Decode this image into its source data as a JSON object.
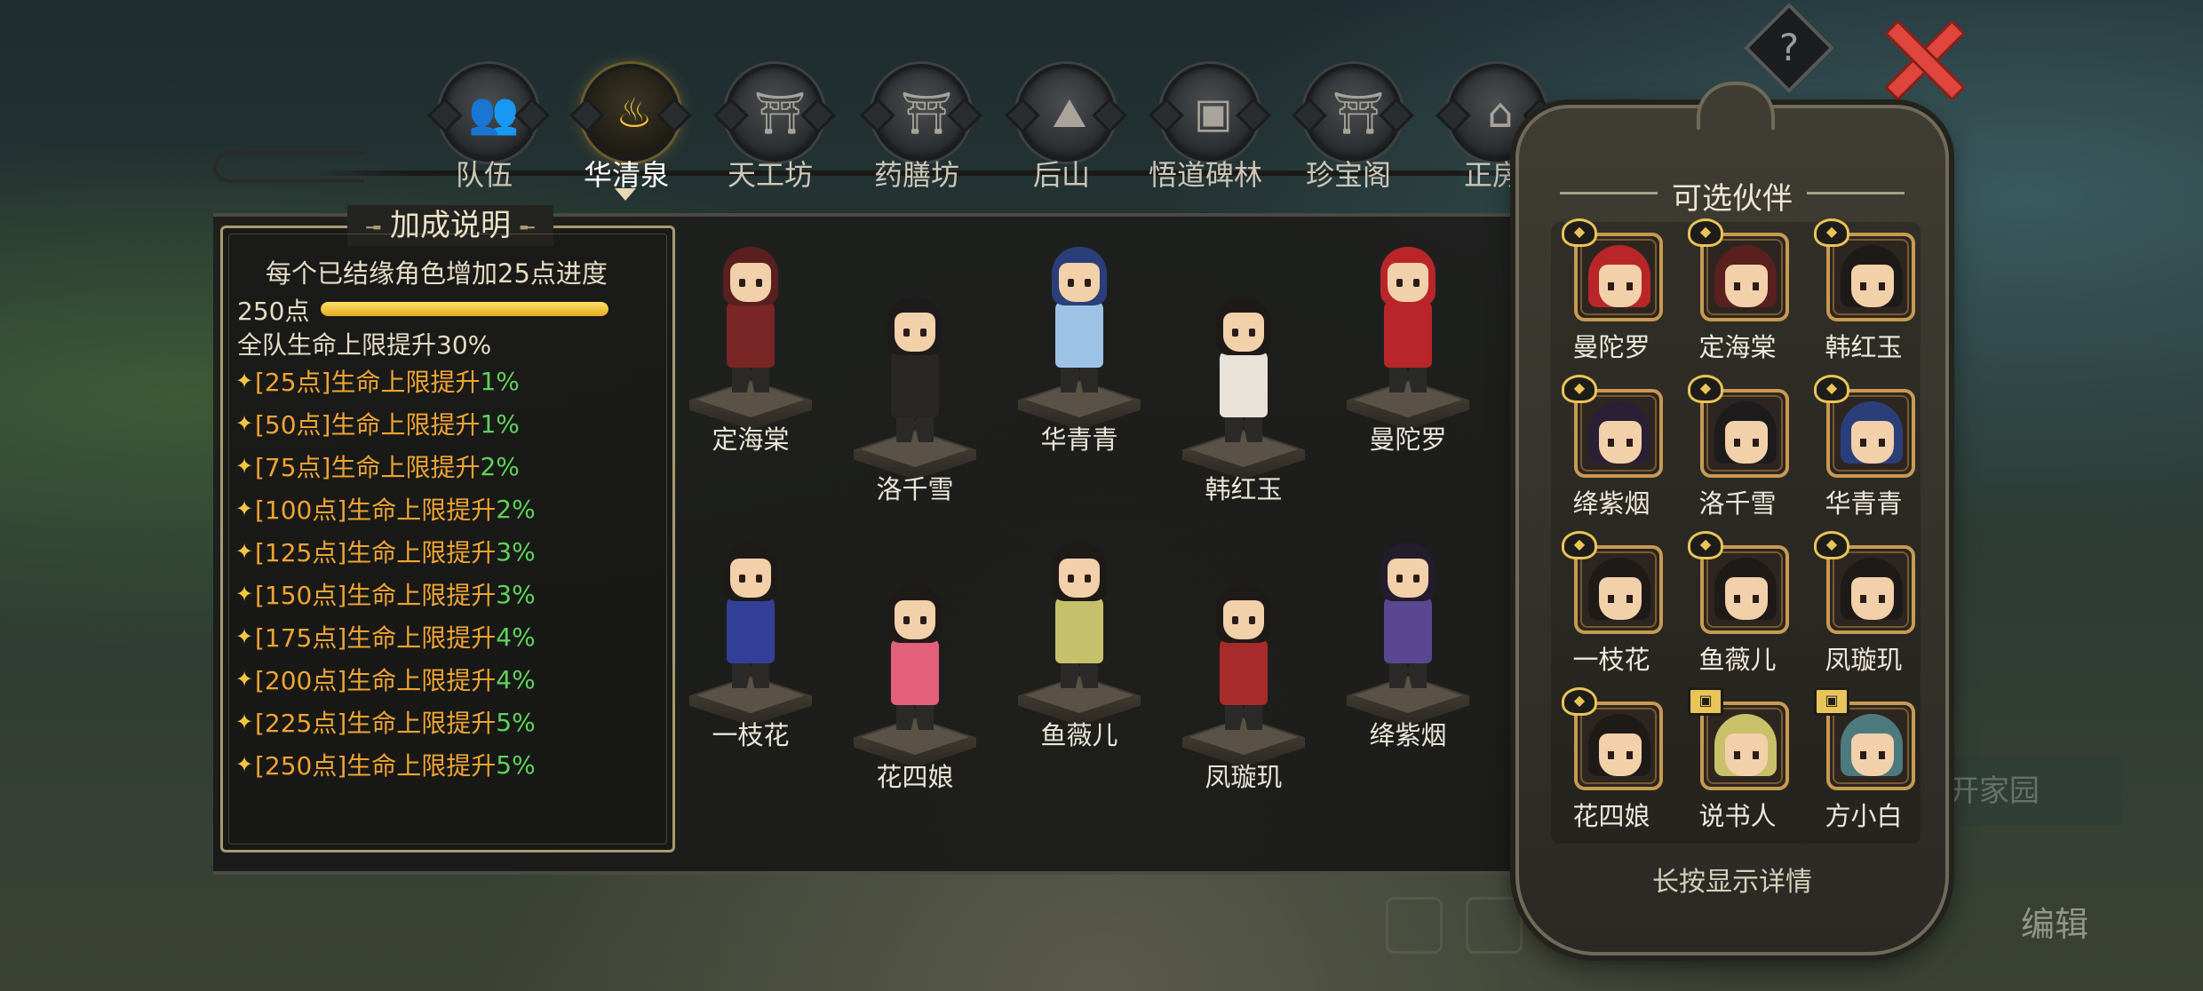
{
  "nav": {
    "tabs": [
      {
        "label": "队伍",
        "icon": "team-icon",
        "glyph": "👥"
      },
      {
        "label": "华清泉",
        "icon": "hot-spring-icon",
        "glyph": "♨"
      },
      {
        "label": "天工坊",
        "icon": "workshop-icon",
        "glyph": "⛩"
      },
      {
        "label": "药膳坊",
        "icon": "kitchen-icon",
        "glyph": "⛩"
      },
      {
        "label": "后山",
        "icon": "mountain-icon",
        "glyph": "⛰"
      },
      {
        "label": "悟道碑林",
        "icon": "stele-icon",
        "glyph": "▣"
      },
      {
        "label": "珍宝阁",
        "icon": "pavilion-icon",
        "glyph": "⛩"
      },
      {
        "label": "正房",
        "icon": "house-icon",
        "glyph": "⌂"
      }
    ],
    "active_index": 1
  },
  "controls": {
    "help_label": "?"
  },
  "bonus": {
    "title": "加成说明",
    "description": "每个已结缘角色增加25点进度",
    "progress_label": "250点",
    "progress_fraction": 1.0,
    "summary": "全队生命上限提升30%",
    "tiers": [
      {
        "text": "[25点]生命上限提升",
        "value": "1%"
      },
      {
        "text": "[50点]生命上限提升",
        "value": "1%"
      },
      {
        "text": "[75点]生命上限提升",
        "value": "2%"
      },
      {
        "text": "[100点]生命上限提升",
        "value": "2%"
      },
      {
        "text": "[125点]生命上限提升",
        "value": "3%"
      },
      {
        "text": "[150点]生命上限提升",
        "value": "3%"
      },
      {
        "text": "[175点]生命上限提升",
        "value": "4%"
      },
      {
        "text": "[200点]生命上限提升",
        "value": "4%"
      },
      {
        "text": "[225点]生命上限提升",
        "value": "5%"
      },
      {
        "text": "[250点]生命上限提升",
        "value": "5%"
      }
    ]
  },
  "roster": [
    {
      "name": "定海棠",
      "hair": "#5a1f1f",
      "body": "#7a2626"
    },
    {
      "name": "洛千雪",
      "hair": "#1d1b1b",
      "body": "#2a2624"
    },
    {
      "name": "华青青",
      "hair": "#2a3f7a",
      "body": "#9cc3e6"
    },
    {
      "name": "韩红玉",
      "hair": "#1e1a18",
      "body": "#e9e2d8"
    },
    {
      "name": "曼陀罗",
      "hair": "#b8262a",
      "body": "#b8262a"
    },
    {
      "name": "一枝花",
      "hair": "#1e1a18",
      "body": "#33409a"
    },
    {
      "name": "花四娘",
      "hair": "#1e1a18",
      "body": "#e3607a"
    },
    {
      "name": "鱼薇儿",
      "hair": "#1e1a18",
      "body": "#c7c06b"
    },
    {
      "name": "凤璇玑",
      "hair": "#1e1a18",
      "body": "#a82b2b"
    },
    {
      "name": "绛紫烟",
      "hair": "#221c2c",
      "body": "#5b4690"
    }
  ],
  "partners": {
    "title": "可选伙伴",
    "hint": "长按显示详情",
    "items": [
      {
        "name": "曼陀罗",
        "hair": "#b8262a",
        "locked": false
      },
      {
        "name": "定海棠",
        "hair": "#5a1f1f",
        "locked": false
      },
      {
        "name": "韩红玉",
        "hair": "#1e1a18",
        "locked": false
      },
      {
        "name": "绛紫烟",
        "hair": "#2a2036",
        "locked": false
      },
      {
        "name": "洛千雪",
        "hair": "#1d1b1b",
        "locked": false
      },
      {
        "name": "华青青",
        "hair": "#2a3f7a",
        "locked": false
      },
      {
        "name": "一枝花",
        "hair": "#1e1a18",
        "locked": false
      },
      {
        "name": "鱼薇儿",
        "hair": "#1e1a18",
        "locked": false
      },
      {
        "name": "凤璇玑",
        "hair": "#1e1a18",
        "locked": false
      },
      {
        "name": "花四娘",
        "hair": "#1e1a18",
        "locked": false
      },
      {
        "name": "说书人",
        "hair": "#c9c06a",
        "locked": true
      },
      {
        "name": "方小白",
        "hair": "#4d7a7e",
        "locked": true
      }
    ]
  },
  "background": {
    "button_label": "离开家园",
    "edit_label": "编辑"
  }
}
